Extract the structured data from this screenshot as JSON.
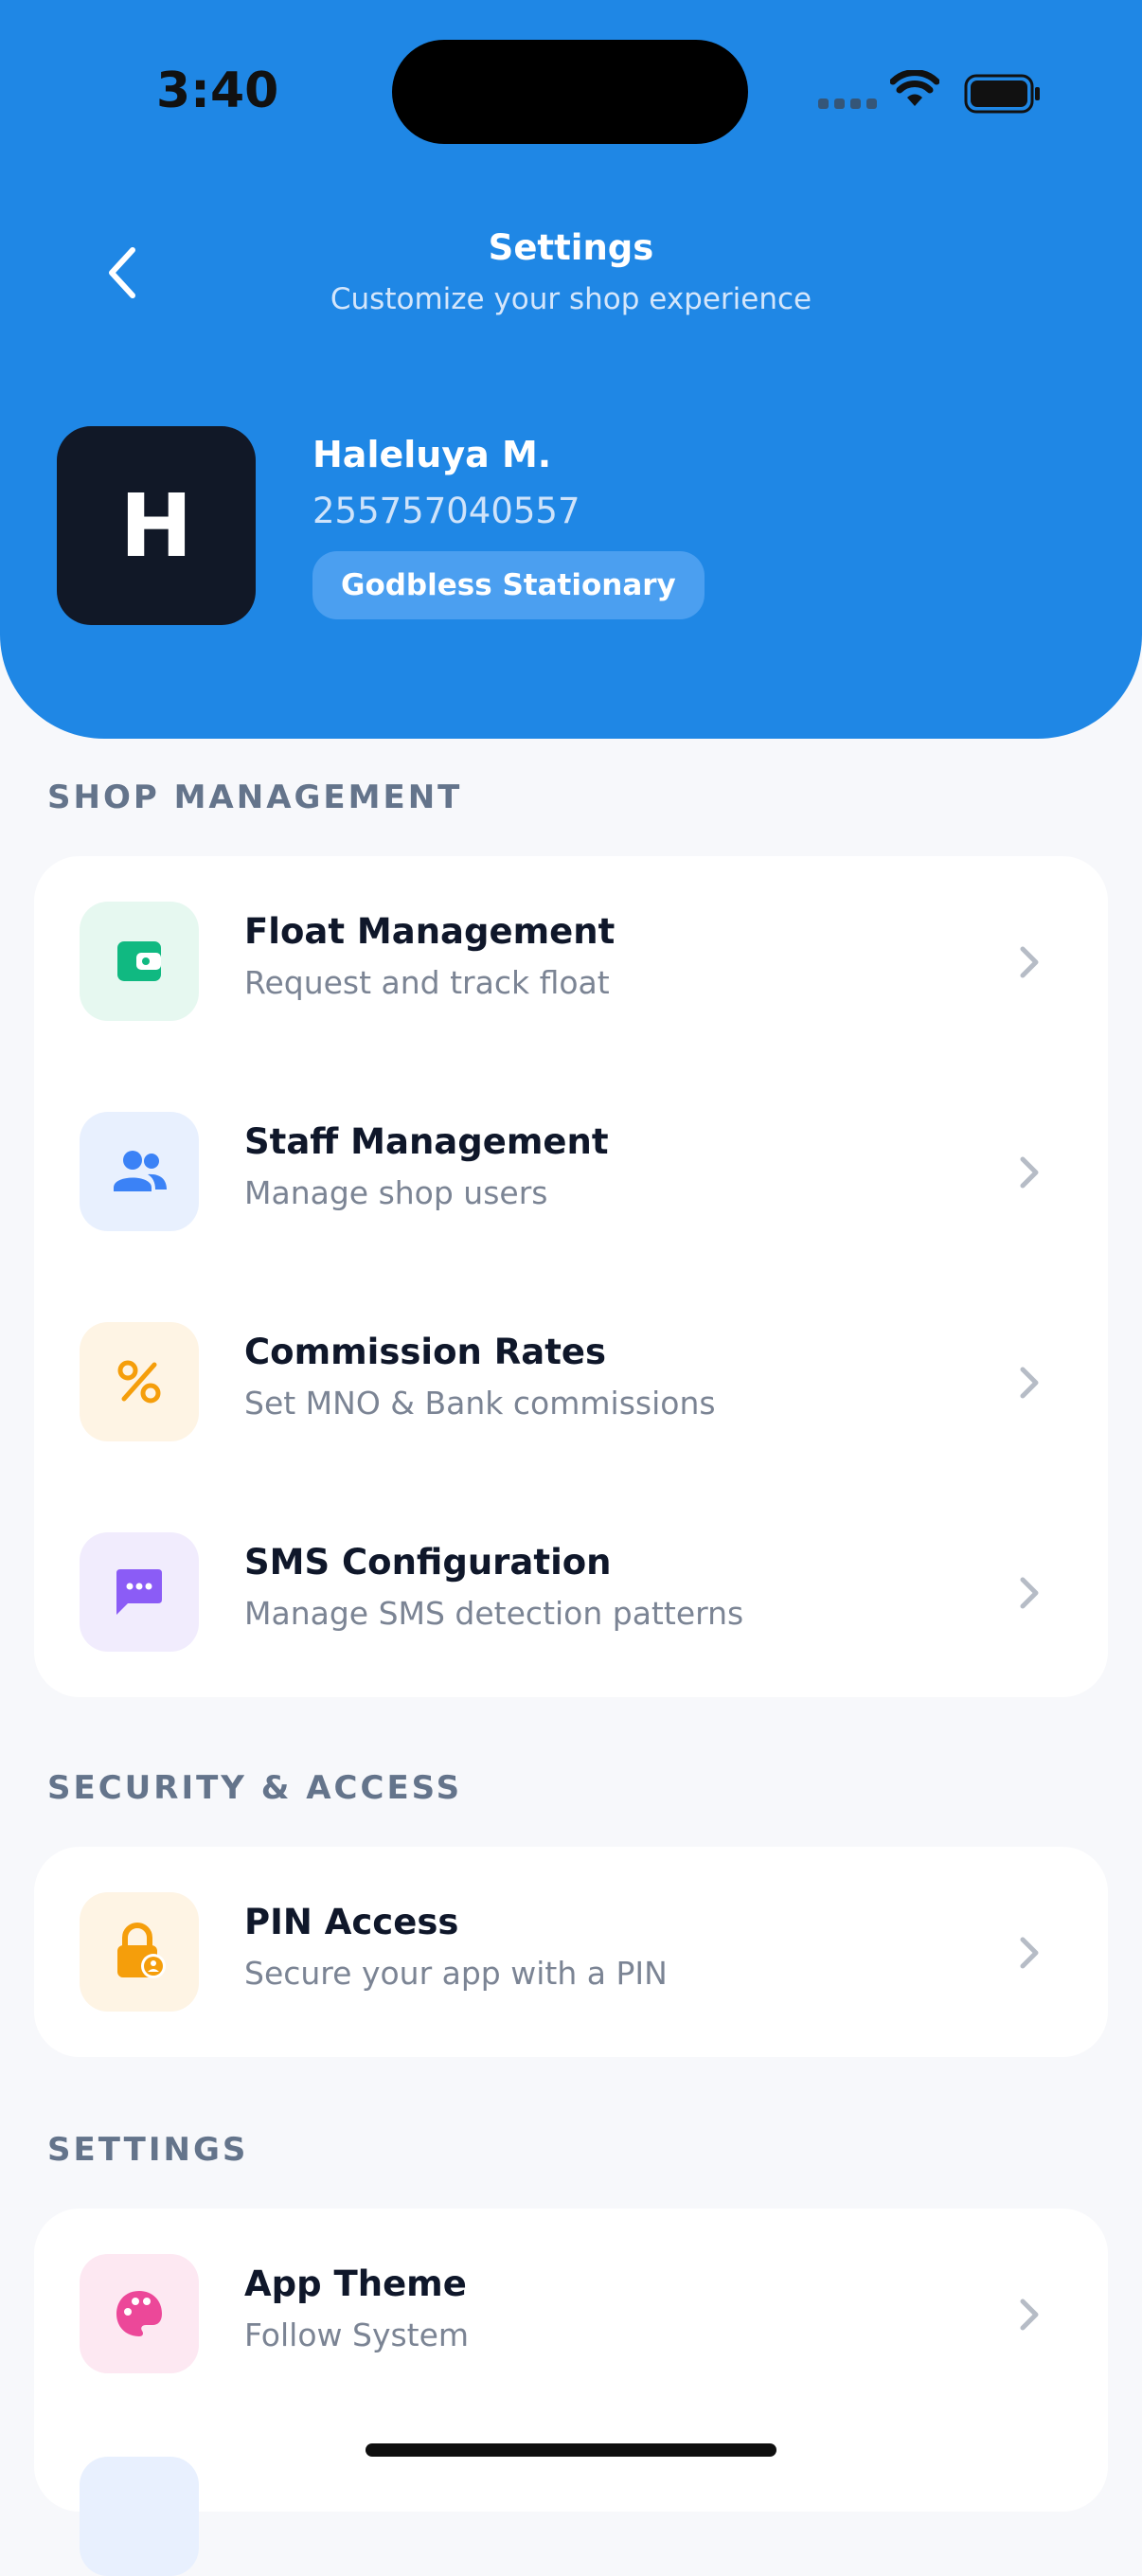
{
  "status_bar": {
    "time": "3:40"
  },
  "header": {
    "title": "Settings",
    "subtitle": "Customize your shop experience"
  },
  "profile": {
    "initial": "H",
    "name": "Haleluya M.",
    "phone": "255757040557",
    "shop": "Godbless Stationary"
  },
  "sections": {
    "shop_management": {
      "title": "SHOP MANAGEMENT",
      "items": [
        {
          "title": "Float Management",
          "subtitle": "Request and track float",
          "icon": "wallet-icon"
        },
        {
          "title": "Staff Management",
          "subtitle": "Manage shop users",
          "icon": "users-icon"
        },
        {
          "title": "Commission Rates",
          "subtitle": "Set MNO & Bank commissions",
          "icon": "percent-icon"
        },
        {
          "title": "SMS Configuration",
          "subtitle": "Manage SMS detection patterns",
          "icon": "message-icon"
        }
      ]
    },
    "security": {
      "title": "SECURITY & ACCESS",
      "items": [
        {
          "title": "PIN Access",
          "subtitle": "Secure your app with a PIN",
          "icon": "lock-icon"
        }
      ]
    },
    "settings": {
      "title": "SETTINGS",
      "items": [
        {
          "title": "App Theme",
          "subtitle": "Follow System",
          "icon": "palette-icon"
        }
      ]
    }
  },
  "colors": {
    "header_bg": "#1f87e5",
    "green": "#10b981",
    "blue": "#3b82f6",
    "orange": "#f59e0b",
    "purple": "#8b5cf6",
    "pink": "#ec4899"
  }
}
